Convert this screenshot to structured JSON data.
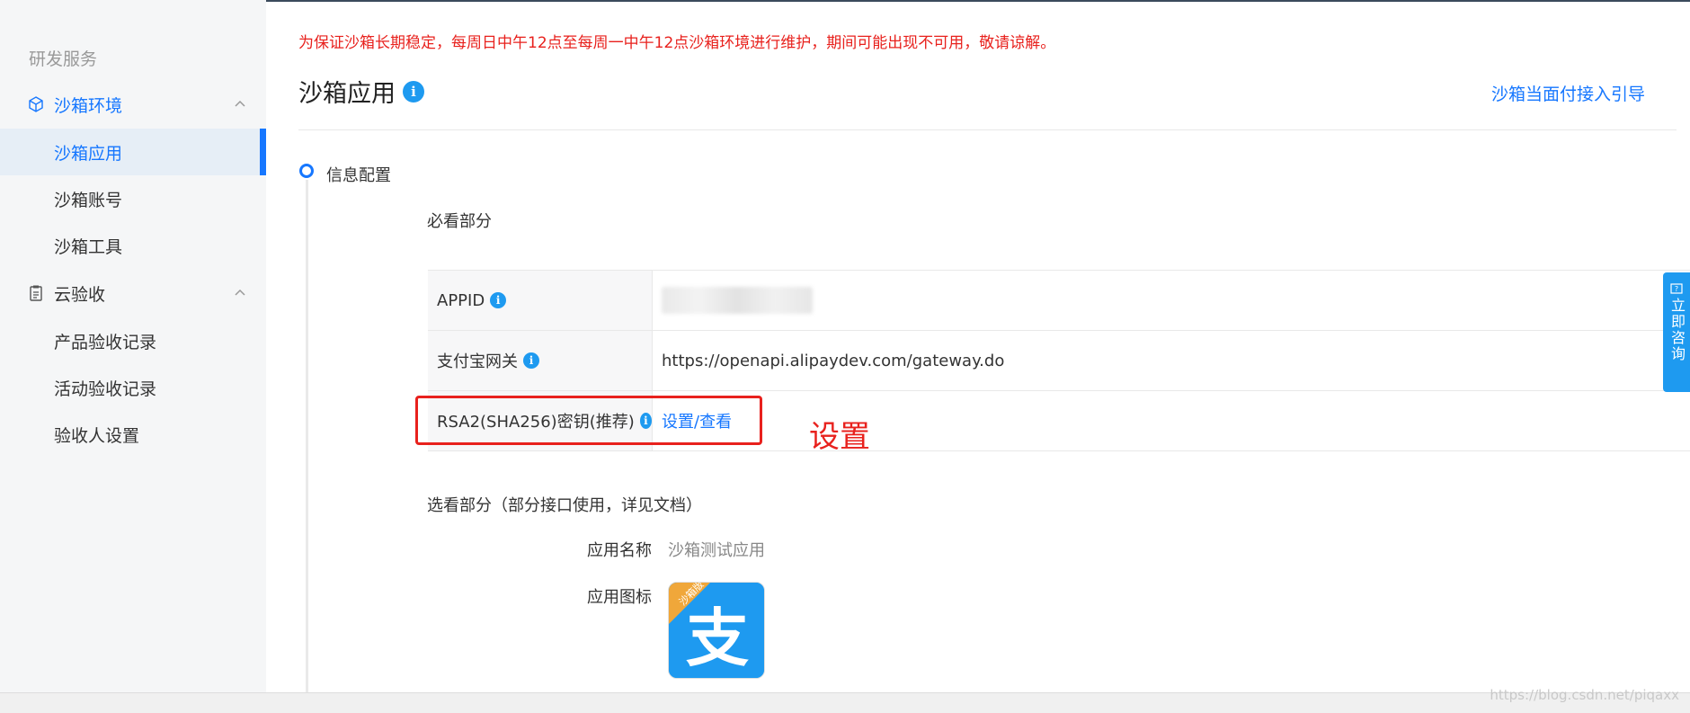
{
  "sidebar": {
    "section_label": "研发服务",
    "groups": [
      {
        "label": "沙箱环境",
        "icon": "cube-icon",
        "expanded": true,
        "accent": "#1677ff"
      },
      {
        "label": "云验收",
        "icon": "clipboard-icon",
        "expanded": true
      }
    ],
    "items": [
      {
        "label": "沙箱应用",
        "active": true
      },
      {
        "label": "沙箱账号"
      },
      {
        "label": "沙箱工具"
      },
      {
        "label": "产品验收记录"
      },
      {
        "label": "活动验收记录"
      },
      {
        "label": "验收人设置"
      }
    ]
  },
  "main": {
    "notice": "为保证沙箱长期稳定，每周日中午12点至每周一中午12点沙箱环境进行维护，期间可能出现不可用，敬请谅解。",
    "title": "沙箱应用",
    "guide_link": "沙箱当面付接入引导",
    "section_title": "信息配置",
    "required_title": "必看部分",
    "rows": [
      {
        "label": "APPID",
        "value": ""
      },
      {
        "label": "支付宝网关",
        "value": "https://openapi.alipaydev.com/gateway.do"
      },
      {
        "label": "RSA2(SHA256)密钥(推荐)",
        "link": "设置/查看"
      }
    ],
    "annotation": "设置",
    "optional_title": "选看部分（部分接口使用，详见文档）",
    "app_name_label": "应用名称",
    "app_name_value": "沙箱测试应用",
    "app_icon_label": "应用图标",
    "app_icon_badge": "沙箱版",
    "app_icon_glyph": "支"
  },
  "help_button": {
    "icon": "question-icon",
    "label": "立即咨询"
  },
  "watermark": "https://blog.csdn.net/piqaxx",
  "colors": {
    "brand": "#1677ff",
    "notice_red": "#e8211d",
    "info_blue": "#1e9af0"
  }
}
